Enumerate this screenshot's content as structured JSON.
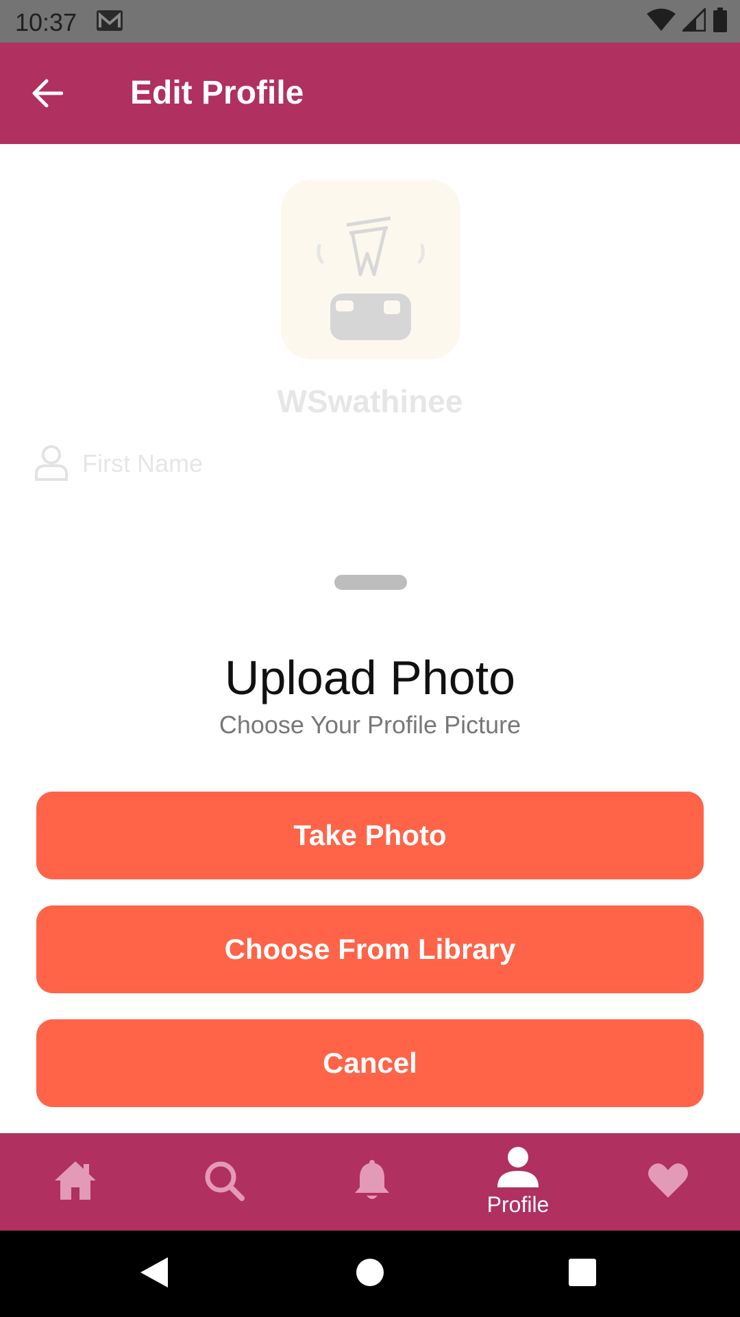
{
  "status_bar": {
    "time": "10:37",
    "icons": [
      "mail-icon",
      "wifi-icon",
      "signal-icon",
      "battery-icon"
    ]
  },
  "app_bar": {
    "title": "Edit Profile",
    "back_icon": "arrow-left-icon"
  },
  "profile": {
    "username": "WSwathinee",
    "first_name_placeholder": "First Name",
    "first_name_value": ""
  },
  "sheet": {
    "title": "Upload Photo",
    "subtitle": "Choose Your Profile Picture",
    "buttons": {
      "take_photo": "Take Photo",
      "choose_library": "Choose From Library",
      "cancel": "Cancel"
    }
  },
  "bottom_nav": {
    "items": [
      {
        "icon": "home-icon",
        "label": ""
      },
      {
        "icon": "search-icon",
        "label": ""
      },
      {
        "icon": "bell-icon",
        "label": ""
      },
      {
        "icon": "person-icon",
        "label": "Profile",
        "active": true
      },
      {
        "icon": "heart-icon",
        "label": ""
      }
    ]
  },
  "colors": {
    "brand": "#b0305f",
    "accent": "#ff6348",
    "nav_inactive": "#e39ab6",
    "nav_active": "#ffffff"
  }
}
